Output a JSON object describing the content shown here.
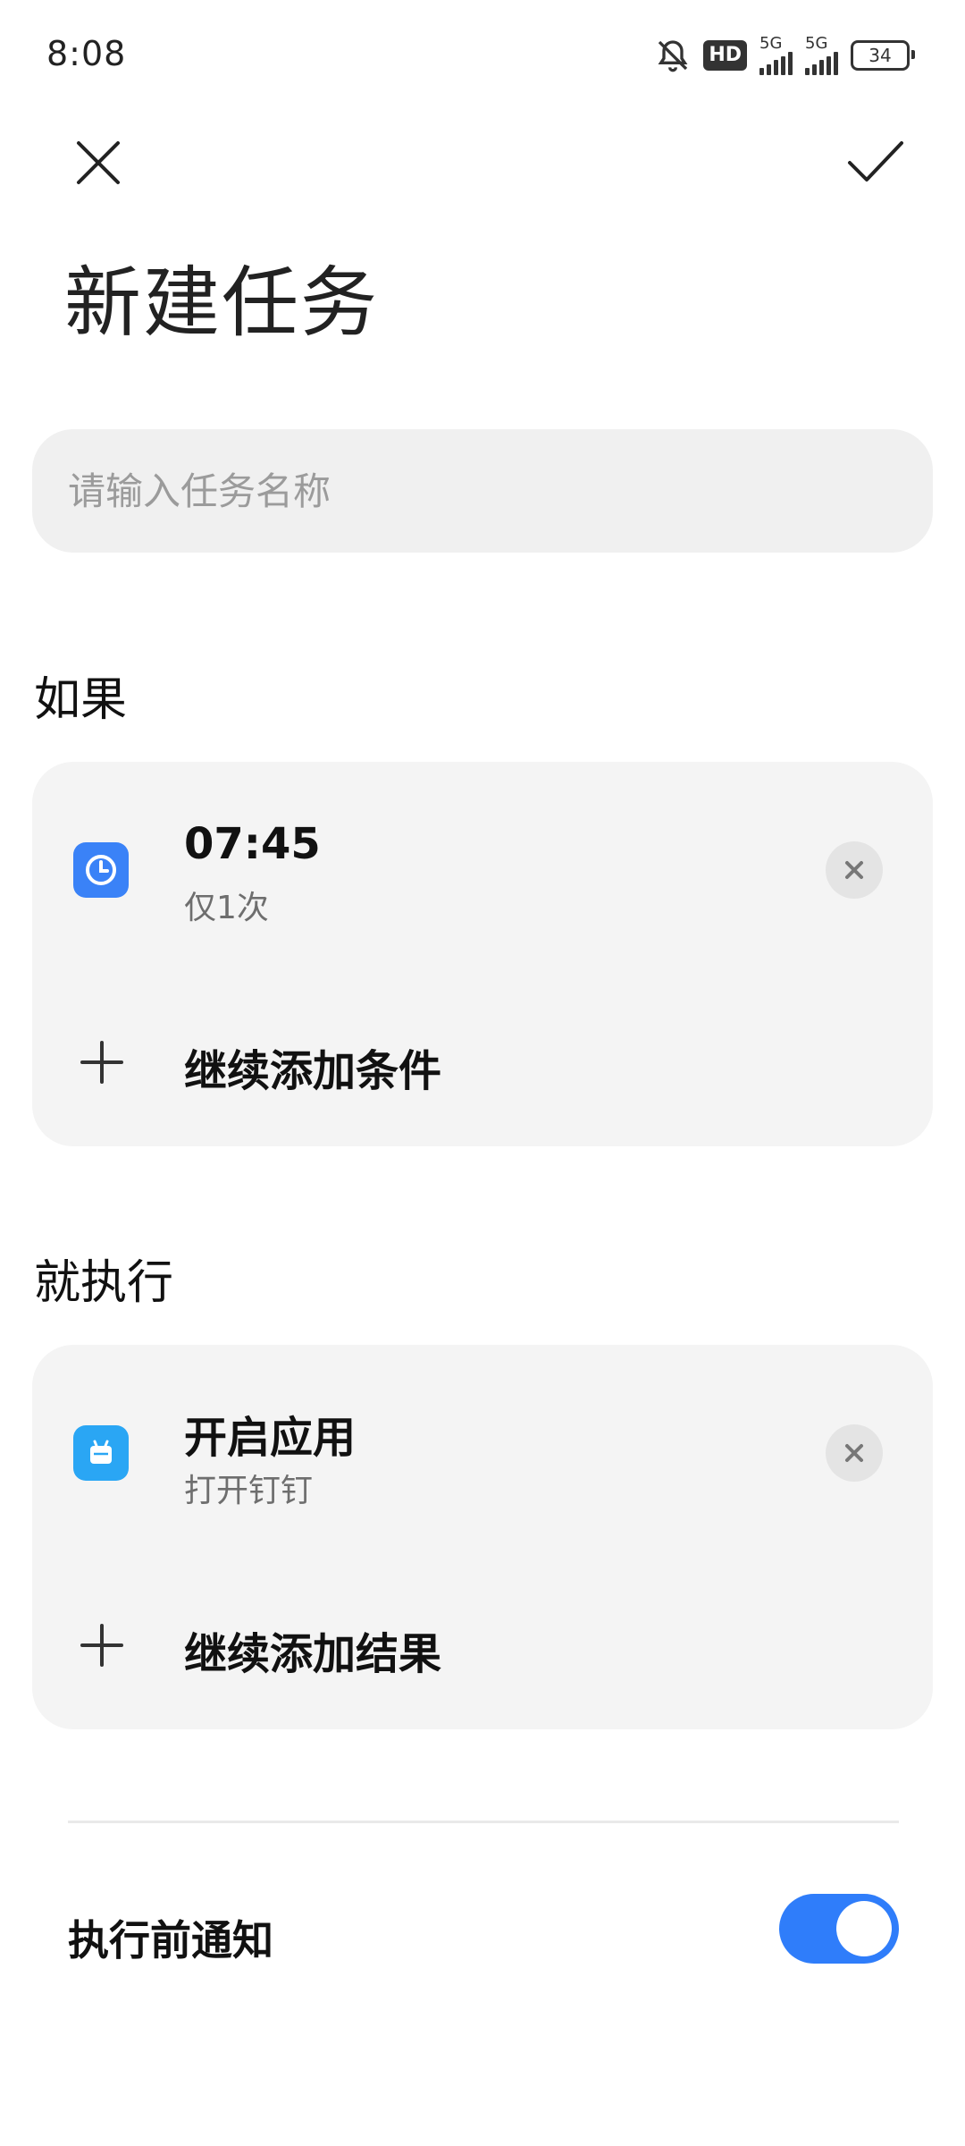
{
  "status_bar": {
    "time": "8:08",
    "hd_label": "HD",
    "network1_label": "5G",
    "network2_label": "5G",
    "battery_level": "34"
  },
  "header": {
    "title": "新建任务",
    "close_icon": "close-icon",
    "confirm_icon": "checkmark-icon"
  },
  "task_name": {
    "placeholder": "请输入任务名称",
    "value": ""
  },
  "if_section": {
    "label": "如果",
    "condition": {
      "icon": "clock-icon",
      "title": "07:45",
      "subtitle": "仅1次"
    },
    "add_label": "继续添加条件"
  },
  "then_section": {
    "label": "就执行",
    "action": {
      "icon": "app-icon",
      "title": "开启应用",
      "subtitle": "打开钉钉"
    },
    "add_label": "继续添加结果"
  },
  "notify": {
    "label": "执行前通知",
    "enabled": true
  },
  "colors": {
    "accent": "#2f7dfa",
    "clock_icon_bg": "#3a82f7",
    "app_icon_bg": "#2aa6f4",
    "card_bg": "#f4f4f4"
  }
}
